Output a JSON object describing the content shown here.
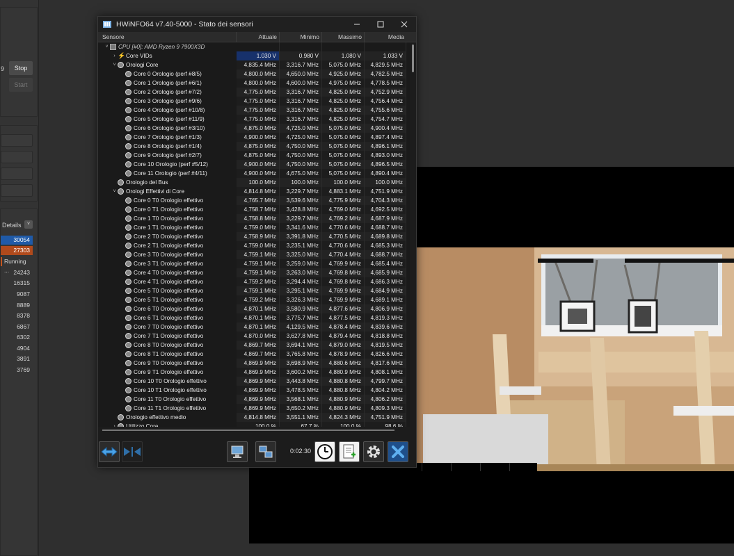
{
  "window": {
    "title": "HWiNFO64 v7.40-5000 - Stato dei sensori",
    "minimize": "–",
    "maximize": "☐",
    "close": "✕"
  },
  "columns": {
    "sensor": "Sensore",
    "current": "Attuale",
    "min": "Minimo",
    "max": "Massimo",
    "avg": "Media"
  },
  "rows": [
    {
      "name": "CPU [#0]: AMD Ryzen 9 7900X3D",
      "indent": 0,
      "toggle": "˅",
      "icon": "chip",
      "type": "group",
      "vals": [
        "",
        "",
        "",
        ""
      ]
    },
    {
      "name": "Core VIDs",
      "indent": 1,
      "toggle": "›",
      "icon": "bolt",
      "type": "row",
      "sel": true,
      "vals": [
        "1.030 V",
        "0.980 V",
        "1.080 V",
        "1.033 V"
      ]
    },
    {
      "name": "Orologi Core",
      "indent": 1,
      "toggle": "˅",
      "icon": "clock",
      "type": "row",
      "vals": [
        "4,835.4 MHz",
        "3,316.7 MHz",
        "5,075.0 MHz",
        "4,829.5 MHz"
      ]
    },
    {
      "name": "Core 0 Orologio (perf #8/5)",
      "indent": 2,
      "toggle": "",
      "icon": "clock",
      "type": "row",
      "vals": [
        "4,800.0 MHz",
        "4,650.0 MHz",
        "4,925.0 MHz",
        "4,782.5 MHz"
      ]
    },
    {
      "name": "Core 1 Orologio (perf #6/1)",
      "indent": 2,
      "toggle": "",
      "icon": "clock",
      "type": "row",
      "vals": [
        "4,800.0 MHz",
        "4,600.0 MHz",
        "4,975.0 MHz",
        "4,778.5 MHz"
      ]
    },
    {
      "name": "Core 2 Orologio (perf #7/2)",
      "indent": 2,
      "toggle": "",
      "icon": "clock",
      "type": "row",
      "vals": [
        "4,775.0 MHz",
        "3,316.7 MHz",
        "4,825.0 MHz",
        "4,752.9 MHz"
      ]
    },
    {
      "name": "Core 3 Orologio (perf #9/6)",
      "indent": 2,
      "toggle": "",
      "icon": "clock",
      "type": "row",
      "vals": [
        "4,775.0 MHz",
        "3,316.7 MHz",
        "4,825.0 MHz",
        "4,756.4 MHz"
      ]
    },
    {
      "name": "Core 4 Orologio (perf #10/8)",
      "indent": 2,
      "toggle": "",
      "icon": "clock",
      "type": "row",
      "vals": [
        "4,775.0 MHz",
        "3,316.7 MHz",
        "4,825.0 MHz",
        "4,755.6 MHz"
      ]
    },
    {
      "name": "Core 5 Orologio (perf #11/9)",
      "indent": 2,
      "toggle": "",
      "icon": "clock",
      "type": "row",
      "vals": [
        "4,775.0 MHz",
        "3,316.7 MHz",
        "4,825.0 MHz",
        "4,754.7 MHz"
      ]
    },
    {
      "name": "Core 6 Orologio (perf #3/10)",
      "indent": 2,
      "toggle": "",
      "icon": "clock",
      "type": "row",
      "vals": [
        "4,875.0 MHz",
        "4,725.0 MHz",
        "5,075.0 MHz",
        "4,900.4 MHz"
      ]
    },
    {
      "name": "Core 7 Orologio (perf #1/3)",
      "indent": 2,
      "toggle": "",
      "icon": "clock",
      "type": "row",
      "vals": [
        "4,900.0 MHz",
        "4,725.0 MHz",
        "5,075.0 MHz",
        "4,897.4 MHz"
      ]
    },
    {
      "name": "Core 8 Orologio (perf #1/4)",
      "indent": 2,
      "toggle": "",
      "icon": "clock",
      "type": "row",
      "vals": [
        "4,875.0 MHz",
        "4,750.0 MHz",
        "5,075.0 MHz",
        "4,896.1 MHz"
      ]
    },
    {
      "name": "Core 9 Orologio (perf #2/7)",
      "indent": 2,
      "toggle": "",
      "icon": "clock",
      "type": "row",
      "vals": [
        "4,875.0 MHz",
        "4,750.0 MHz",
        "5,075.0 MHz",
        "4,893.0 MHz"
      ]
    },
    {
      "name": "Core 10 Orologio (perf #5/12)",
      "indent": 2,
      "toggle": "",
      "icon": "clock",
      "type": "row",
      "vals": [
        "4,900.0 MHz",
        "4,750.0 MHz",
        "5,075.0 MHz",
        "4,896.5 MHz"
      ]
    },
    {
      "name": "Core 11 Orologio (perf #4/11)",
      "indent": 2,
      "toggle": "",
      "icon": "clock",
      "type": "row",
      "vals": [
        "4,900.0 MHz",
        "4,675.0 MHz",
        "5,075.0 MHz",
        "4,890.4 MHz"
      ]
    },
    {
      "name": "Orologio del Bus",
      "indent": 1,
      "toggle": "",
      "icon": "clock",
      "type": "row",
      "vals": [
        "100.0 MHz",
        "100.0 MHz",
        "100.0 MHz",
        "100.0 MHz"
      ]
    },
    {
      "name": "Orologi Effettivi di Core",
      "indent": 1,
      "toggle": "˅",
      "icon": "clock",
      "type": "row",
      "vals": [
        "4,814.8 MHz",
        "3,229.7 MHz",
        "4,883.1 MHz",
        "4,751.9 MHz"
      ]
    },
    {
      "name": "Core 0 T0 Orologio effettivo",
      "indent": 2,
      "toggle": "",
      "icon": "clock",
      "type": "row",
      "vals": [
        "4,765.7 MHz",
        "3,539.6 MHz",
        "4,775.9 MHz",
        "4,704.3 MHz"
      ]
    },
    {
      "name": "Core 0 T1 Orologio effettivo",
      "indent": 2,
      "toggle": "",
      "icon": "clock",
      "type": "row",
      "vals": [
        "4,758.7 MHz",
        "3,428.8 MHz",
        "4,769.0 MHz",
        "4,692.5 MHz"
      ]
    },
    {
      "name": "Core 1 T0 Orologio effettivo",
      "indent": 2,
      "toggle": "",
      "icon": "clock",
      "type": "row",
      "vals": [
        "4,758.8 MHz",
        "3,229.7 MHz",
        "4,769.2 MHz",
        "4,687.9 MHz"
      ]
    },
    {
      "name": "Core 1 T1 Orologio effettivo",
      "indent": 2,
      "toggle": "",
      "icon": "clock",
      "type": "row",
      "vals": [
        "4,759.0 MHz",
        "3,341.6 MHz",
        "4,770.6 MHz",
        "4,688.7 MHz"
      ]
    },
    {
      "name": "Core 2 T0 Orologio effettivo",
      "indent": 2,
      "toggle": "",
      "icon": "clock",
      "type": "row",
      "vals": [
        "4,758.9 MHz",
        "3,391.8 MHz",
        "4,770.5 MHz",
        "4,689.8 MHz"
      ]
    },
    {
      "name": "Core 2 T1 Orologio effettivo",
      "indent": 2,
      "toggle": "",
      "icon": "clock",
      "type": "row",
      "vals": [
        "4,759.0 MHz",
        "3,235.1 MHz",
        "4,770.6 MHz",
        "4,685.3 MHz"
      ]
    },
    {
      "name": "Core 3 T0 Orologio effettivo",
      "indent": 2,
      "toggle": "",
      "icon": "clock",
      "type": "row",
      "vals": [
        "4,759.1 MHz",
        "3,325.0 MHz",
        "4,770.4 MHz",
        "4,688.7 MHz"
      ]
    },
    {
      "name": "Core 3 T1 Orologio effettivo",
      "indent": 2,
      "toggle": "",
      "icon": "clock",
      "type": "row",
      "vals": [
        "4,759.1 MHz",
        "3,259.0 MHz",
        "4,769.9 MHz",
        "4,685.4 MHz"
      ]
    },
    {
      "name": "Core 4 T0 Orologio effettivo",
      "indent": 2,
      "toggle": "",
      "icon": "clock",
      "type": "row",
      "vals": [
        "4,759.1 MHz",
        "3,263.0 MHz",
        "4,769.8 MHz",
        "4,685.9 MHz"
      ]
    },
    {
      "name": "Core 4 T1 Orologio effettivo",
      "indent": 2,
      "toggle": "",
      "icon": "clock",
      "type": "row",
      "vals": [
        "4,759.2 MHz",
        "3,294.4 MHz",
        "4,769.8 MHz",
        "4,686.3 MHz"
      ]
    },
    {
      "name": "Core 5 T0 Orologio effettivo",
      "indent": 2,
      "toggle": "",
      "icon": "clock",
      "type": "row",
      "vals": [
        "4,759.1 MHz",
        "3,295.1 MHz",
        "4,769.9 MHz",
        "4,684.9 MHz"
      ]
    },
    {
      "name": "Core 5 T1 Orologio effettivo",
      "indent": 2,
      "toggle": "",
      "icon": "clock",
      "type": "row",
      "vals": [
        "4,759.2 MHz",
        "3,326.3 MHz",
        "4,769.9 MHz",
        "4,689.1 MHz"
      ]
    },
    {
      "name": "Core 6 T0 Orologio effettivo",
      "indent": 2,
      "toggle": "",
      "icon": "clock",
      "type": "row",
      "vals": [
        "4,870.1 MHz",
        "3,580.9 MHz",
        "4,877.6 MHz",
        "4,806.9 MHz"
      ]
    },
    {
      "name": "Core 6 T1 Orologio effettivo",
      "indent": 2,
      "toggle": "",
      "icon": "clock",
      "type": "row",
      "vals": [
        "4,870.1 MHz",
        "3,775.7 MHz",
        "4,877.5 MHz",
        "4,819.3 MHz"
      ]
    },
    {
      "name": "Core 7 T0 Orologio effettivo",
      "indent": 2,
      "toggle": "",
      "icon": "clock",
      "type": "row",
      "vals": [
        "4,870.1 MHz",
        "4,129.5 MHz",
        "4,878.4 MHz",
        "4,839.6 MHz"
      ]
    },
    {
      "name": "Core 7 T1 Orologio effettivo",
      "indent": 2,
      "toggle": "",
      "icon": "clock",
      "type": "row",
      "vals": [
        "4,870.0 MHz",
        "3,627.8 MHz",
        "4,879.4 MHz",
        "4,818.8 MHz"
      ]
    },
    {
      "name": "Core 8 T0 Orologio effettivo",
      "indent": 2,
      "toggle": "",
      "icon": "clock",
      "type": "row",
      "vals": [
        "4,869.7 MHz",
        "3,694.1 MHz",
        "4,879.0 MHz",
        "4,819.5 MHz"
      ]
    },
    {
      "name": "Core 8 T1 Orologio effettivo",
      "indent": 2,
      "toggle": "",
      "icon": "clock",
      "type": "row",
      "vals": [
        "4,869.7 MHz",
        "3,765.8 MHz",
        "4,878.9 MHz",
        "4,826.6 MHz"
      ]
    },
    {
      "name": "Core 9 T0 Orologio effettivo",
      "indent": 2,
      "toggle": "",
      "icon": "clock",
      "type": "row",
      "vals": [
        "4,869.9 MHz",
        "3,698.9 MHz",
        "4,880.6 MHz",
        "4,817.6 MHz"
      ]
    },
    {
      "name": "Core 9 T1 Orologio effettivo",
      "indent": 2,
      "toggle": "",
      "icon": "clock",
      "type": "row",
      "vals": [
        "4,869.9 MHz",
        "3,600.2 MHz",
        "4,880.9 MHz",
        "4,808.1 MHz"
      ]
    },
    {
      "name": "Core 10 T0 Orologio effettivo",
      "indent": 2,
      "toggle": "",
      "icon": "clock",
      "type": "row",
      "vals": [
        "4,869.9 MHz",
        "3,443.8 MHz",
        "4,880.8 MHz",
        "4,799.7 MHz"
      ]
    },
    {
      "name": "Core 10 T1 Orologio effettivo",
      "indent": 2,
      "toggle": "",
      "icon": "clock",
      "type": "row",
      "vals": [
        "4,869.9 MHz",
        "3,478.5 MHz",
        "4,880.8 MHz",
        "4,804.2 MHz"
      ]
    },
    {
      "name": "Core 11 T0 Orologio effettivo",
      "indent": 2,
      "toggle": "",
      "icon": "clock",
      "type": "row",
      "vals": [
        "4,869.9 MHz",
        "3,568.1 MHz",
        "4,880.9 MHz",
        "4,806.2 MHz"
      ]
    },
    {
      "name": "Core 11 T1 Orologio effettivo",
      "indent": 2,
      "toggle": "",
      "icon": "clock",
      "type": "row",
      "vals": [
        "4,869.9 MHz",
        "3,650.2 MHz",
        "4,880.9 MHz",
        "4,809.3 MHz"
      ]
    },
    {
      "name": "Orologio effettivo medio",
      "indent": 1,
      "toggle": "",
      "icon": "clock",
      "type": "row",
      "vals": [
        "4,814.8 MHz",
        "3,551.1 MHz",
        "4,824.3 MHz",
        "4,751.9 MHz"
      ]
    },
    {
      "name": "Utilizzo Core",
      "indent": 1,
      "toggle": "›",
      "icon": "clock",
      "type": "row",
      "vals": [
        "100.0 %",
        "67.7 %",
        "100.0 %",
        "98.6 %"
      ]
    }
  ],
  "toolbar": {
    "timer": "0:02:30",
    "icons": [
      "arrows-left-right-icon",
      "arrows-collapse-icon",
      "network-monitor-icon",
      "network-icon",
      "clock-icon",
      "report-icon",
      "settings-icon",
      "close-icon"
    ]
  },
  "background_app": {
    "stop_label": "Stop",
    "start_label": "Start",
    "details_label": "Details",
    "left_digit": "9",
    "running_label": "Running ...",
    "numbers": [
      "30054",
      "27303",
      "24243",
      "16315",
      "9087",
      "8889",
      "8378",
      "6867",
      "6302",
      "4904",
      "3891",
      "3769"
    ]
  },
  "colors": {
    "selected_value_bg": "#17316b",
    "window_bg": "#1c1c1c",
    "accent_blue": "#1f5aa8",
    "accent_orange": "#b04a1c"
  }
}
